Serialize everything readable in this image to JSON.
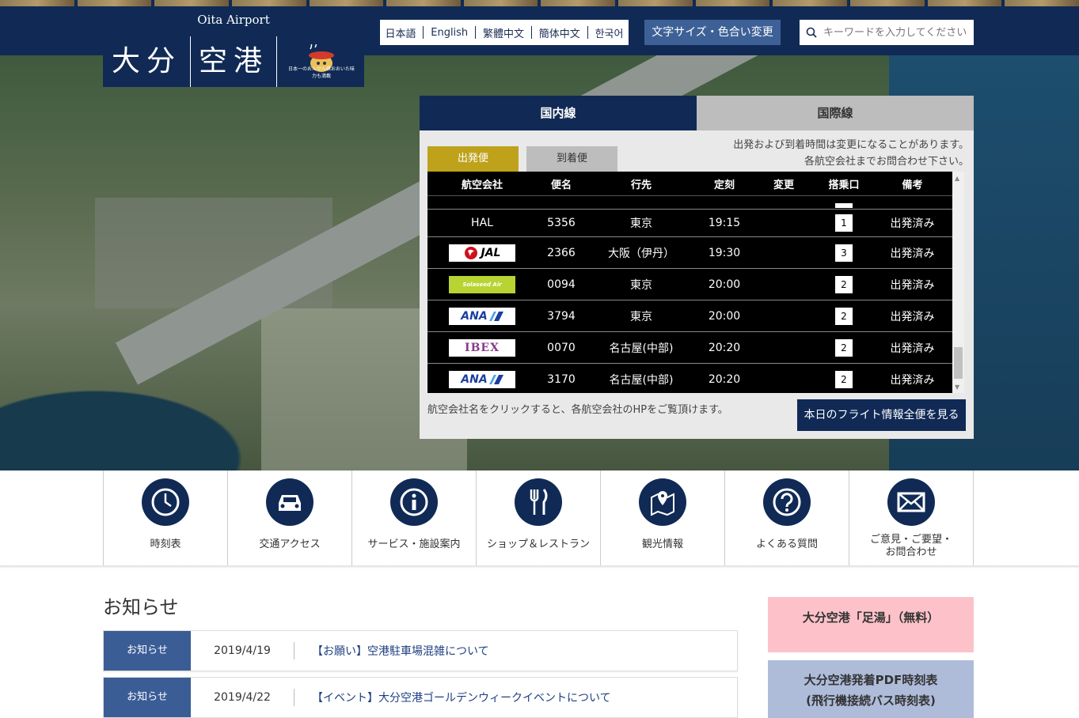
{
  "header": {
    "logo_sub": "Oita Airport",
    "logo_char1": "大分",
    "logo_char2": "空港",
    "onsen_caption": "日本一のおんせん県おおいた味力も満載",
    "languages": [
      "日本語",
      "English",
      "繁體中文",
      "簡体中文",
      "한국어"
    ],
    "font_button": "文字サイズ・色合い変更",
    "search_placeholder": "キーワードを入力してください。"
  },
  "flight_panel": {
    "tabs": [
      "国内線",
      "国際線"
    ],
    "subtabs": [
      "出発便",
      "到着便"
    ],
    "notice_line1": "出発および到着時間は変更になることがあります。",
    "notice_line2": "各航空会社までお問合わせ下さい。",
    "columns": [
      "航空会社",
      "便名",
      "行先",
      "定刻",
      "変更",
      "搭乗口",
      "備考"
    ],
    "rows": [
      {
        "airline": "HAL",
        "airline_icon": "hal-text",
        "number": "5356",
        "dest": "東京",
        "time": "19:15",
        "change": "",
        "gate": "1",
        "remark": "出発済み"
      },
      {
        "airline": "JAL",
        "airline_icon": "jal-logo",
        "number": "2366",
        "dest": "大阪（伊丹）",
        "time": "19:30",
        "change": "",
        "gate": "3",
        "remark": "出発済み"
      },
      {
        "airline": "Solaseed Air",
        "airline_icon": "solaseed-logo",
        "number": "0094",
        "dest": "東京",
        "time": "20:00",
        "change": "",
        "gate": "2",
        "remark": "出発済み"
      },
      {
        "airline": "ANA",
        "airline_icon": "ana-logo",
        "number": "3794",
        "dest": "東京",
        "time": "20:00",
        "change": "",
        "gate": "2",
        "remark": "出発済み"
      },
      {
        "airline": "IBEX",
        "airline_icon": "ibex-logo",
        "number": "0070",
        "dest": "名古屋(中部)",
        "time": "20:20",
        "change": "",
        "gate": "2",
        "remark": "出発済み"
      },
      {
        "airline": "ANA",
        "airline_icon": "ana-logo",
        "number": "3170",
        "dest": "名古屋(中部)",
        "time": "20:20",
        "change": "",
        "gate": "2",
        "remark": "出発済み"
      }
    ],
    "footer_note": "航空会社名をクリックすると、各航空会社のHPをご覧頂けます。",
    "all_flights_button": "本日のフライト情報全便を見る",
    "colors": {
      "navy": "#102a55",
      "gold": "#bfa21b"
    }
  },
  "nav": {
    "items": [
      {
        "label": "時刻表",
        "icon": "clock-icon"
      },
      {
        "label": "交通アクセス",
        "icon": "car-icon"
      },
      {
        "label": "サービス・施設案内",
        "icon": "info-icon"
      },
      {
        "label": "ショップ＆レストラン",
        "icon": "cutlery-icon"
      },
      {
        "label": "観光情報",
        "icon": "map-pin-icon"
      },
      {
        "label": "よくある質問",
        "icon": "question-icon"
      },
      {
        "label": "ご意見・ご要望・",
        "label2": "お問合わせ",
        "icon": "mail-icon"
      }
    ]
  },
  "news": {
    "title": "お知らせ",
    "items": [
      {
        "category": "お知らせ",
        "date": "2019/4/19",
        "text": "【お願い】空港駐車場混雑について"
      },
      {
        "category": "お知らせ",
        "date": "2019/4/22",
        "text": "【イベント】大分空港ゴールデンウィークイベントについて"
      }
    ]
  },
  "sidebar": {
    "banner1": "大分空港「足湯」（無料）",
    "banner2_line1": "大分空港発着PDF時刻表",
    "banner2_line2": "(飛行機接続バス時刻表)"
  }
}
